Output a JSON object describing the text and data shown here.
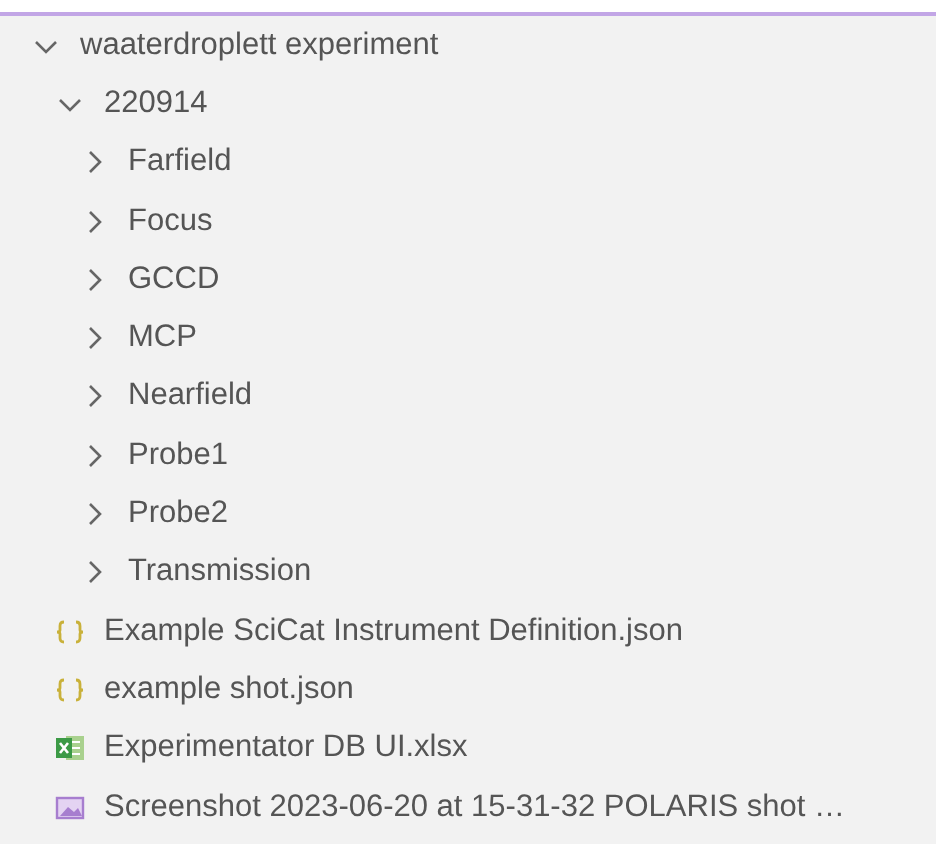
{
  "tree": [
    {
      "label": "waaterdroplett experiment",
      "kind": "folder",
      "expanded": true,
      "children": [
        {
          "label": "220914",
          "kind": "folder",
          "expanded": true,
          "children": [
            {
              "label": "Farfield",
              "kind": "folder",
              "expanded": false
            },
            {
              "label": "Focus",
              "kind": "folder",
              "expanded": false
            },
            {
              "label": "GCCD",
              "kind": "folder",
              "expanded": false
            },
            {
              "label": "MCP",
              "kind": "folder",
              "expanded": false
            },
            {
              "label": "Nearfield",
              "kind": "folder",
              "expanded": false
            },
            {
              "label": "Probe1",
              "kind": "folder",
              "expanded": false
            },
            {
              "label": "Probe2",
              "kind": "folder",
              "expanded": false
            },
            {
              "label": "Transmission",
              "kind": "folder",
              "expanded": false
            }
          ]
        },
        {
          "label": "Example SciCat Instrument Definition.json",
          "kind": "json"
        },
        {
          "label": "example shot.json",
          "kind": "json"
        },
        {
          "label": "Experimentator DB UI.xlsx",
          "kind": "spreadsheet"
        },
        {
          "label": "Screenshot 2023-06-20 at 15-31-32 POLARIS shot …",
          "kind": "image"
        }
      ]
    }
  ]
}
